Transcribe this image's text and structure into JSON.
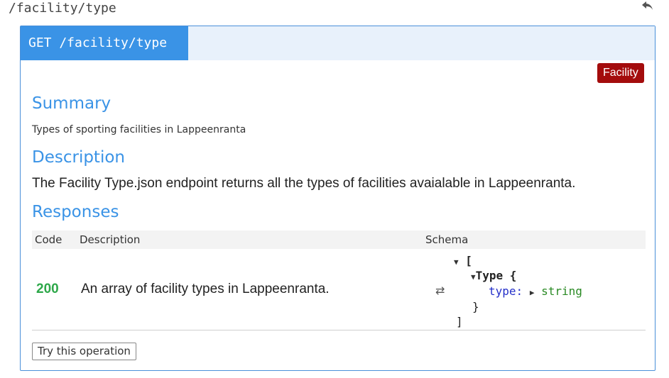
{
  "page": {
    "path_title": "/facility/type",
    "back_icon": "undo-arrow-icon"
  },
  "operation": {
    "method_path": "GET /facility/type",
    "tag": "Facility",
    "summary_heading": "Summary",
    "summary_text": "Types of sporting facilities in Lappeenranta",
    "description_heading": "Description",
    "description_text": "The Facility Type.json endpoint returns all the types of facilities avaialable in Lappeenranta.",
    "responses_heading": "Responses",
    "responses_table": {
      "columns": [
        "Code",
        "Description",
        "Schema"
      ],
      "rows": [
        {
          "code": "200",
          "description": "An array of facility types in Lappeenranta.",
          "schema": {
            "open_bracket": "[",
            "model_name": "Type {",
            "property_name": "type:",
            "property_type": "string",
            "close_brace": "}",
            "close_bracket": "]"
          }
        }
      ]
    },
    "try_button": "Try this operation"
  },
  "colors": {
    "accent_blue": "#3a93e6",
    "tag_red": "#a40c0c",
    "success_green": "#2ea84a",
    "property_blue": "#2530c9",
    "type_green": "#2a8a24"
  },
  "icons": {
    "collapse": "triangle-down-icon",
    "expand": "triangle-right-icon",
    "swap": "swap-arrows-icon"
  }
}
